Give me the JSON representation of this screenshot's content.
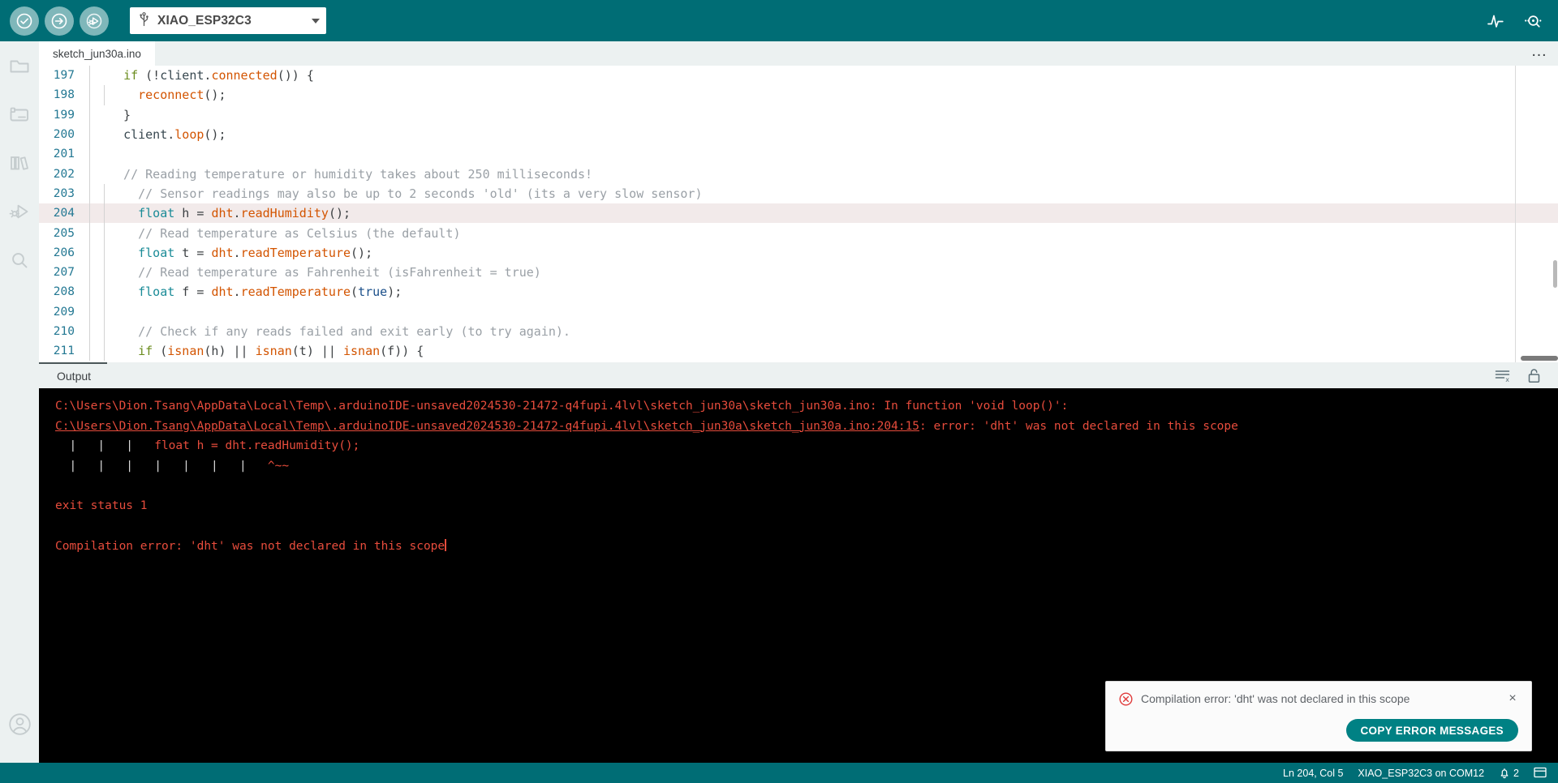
{
  "toolbar": {
    "verify_label": "Verify",
    "upload_label": "Upload",
    "debug_label": "Start Debugging",
    "board_selector": {
      "value": "XIAO_ESP32C3",
      "usb_icon": "usb-icon",
      "caret_icon": "chevron-down-icon"
    },
    "serial_plotter_label": "Serial Plotter",
    "serial_monitor_label": "Serial Monitor"
  },
  "activity_bar": {
    "items": [
      {
        "name": "sketchbook",
        "label": "Sketchbook",
        "icon": "folder-icon"
      },
      {
        "name": "boards-manager",
        "label": "Boards Manager",
        "icon": "boards-manager-icon"
      },
      {
        "name": "library-manager",
        "label": "Library Manager",
        "icon": "books-icon"
      },
      {
        "name": "debug",
        "label": "Debug",
        "icon": "debug-icon"
      },
      {
        "name": "search",
        "label": "Search",
        "icon": "magnifier-icon"
      }
    ],
    "account": {
      "label": "Account",
      "icon": "account-circle-icon"
    }
  },
  "tabs": {
    "items": [
      {
        "label": "sketch_jun30a.ino",
        "active": true
      }
    ],
    "more_label": "…"
  },
  "editor": {
    "lines": [
      {
        "num": "197",
        "indent": 1,
        "tokens": [
          {
            "t": "  ",
            "c": "t-punct"
          },
          {
            "t": "if",
            "c": "t-key"
          },
          {
            "t": " (!",
            "c": "t-punct"
          },
          {
            "t": "client",
            "c": "t-var"
          },
          {
            "t": ".",
            "c": "t-punct"
          },
          {
            "t": "connected",
            "c": "t-fn"
          },
          {
            "t": "()) {",
            "c": "t-punct"
          }
        ]
      },
      {
        "num": "198",
        "indent": 2,
        "tokens": [
          {
            "t": "    ",
            "c": "t-punct"
          },
          {
            "t": "reconnect",
            "c": "t-fn"
          },
          {
            "t": "();",
            "c": "t-punct"
          }
        ]
      },
      {
        "num": "199",
        "indent": 1,
        "tokens": [
          {
            "t": "  }",
            "c": "t-punct"
          }
        ]
      },
      {
        "num": "200",
        "indent": 1,
        "tokens": [
          {
            "t": "  ",
            "c": "t-punct"
          },
          {
            "t": "client",
            "c": "t-var"
          },
          {
            "t": ".",
            "c": "t-punct"
          },
          {
            "t": "loop",
            "c": "t-fn"
          },
          {
            "t": "();",
            "c": "t-punct"
          }
        ]
      },
      {
        "num": "201",
        "indent": 1,
        "tokens": [
          {
            "t": "",
            "c": "t-punct"
          }
        ]
      },
      {
        "num": "202",
        "indent": 1,
        "tokens": [
          {
            "t": "  // Reading temperature or humidity takes about 250 milliseconds!",
            "c": "t-cmt"
          }
        ]
      },
      {
        "num": "203",
        "indent": 2,
        "tokens": [
          {
            "t": "    // Sensor readings may also be up to 2 seconds 'old' (its a very slow sensor)",
            "c": "t-cmt"
          }
        ]
      },
      {
        "num": "204",
        "indent": 2,
        "highlight": true,
        "tokens": [
          {
            "t": "    ",
            "c": "t-punct"
          },
          {
            "t": "float",
            "c": "t-type"
          },
          {
            "t": " h = ",
            "c": "t-punct"
          },
          {
            "t": "dht",
            "c": "t-fn"
          },
          {
            "t": ".",
            "c": "t-punct"
          },
          {
            "t": "readHumidity",
            "c": "t-fn"
          },
          {
            "t": "();",
            "c": "t-punct"
          }
        ]
      },
      {
        "num": "205",
        "indent": 2,
        "tokens": [
          {
            "t": "    // Read temperature as Celsius (the default)",
            "c": "t-cmt"
          }
        ]
      },
      {
        "num": "206",
        "indent": 2,
        "tokens": [
          {
            "t": "    ",
            "c": "t-punct"
          },
          {
            "t": "float",
            "c": "t-type"
          },
          {
            "t": " t = ",
            "c": "t-punct"
          },
          {
            "t": "dht",
            "c": "t-fn"
          },
          {
            "t": ".",
            "c": "t-punct"
          },
          {
            "t": "readTemperature",
            "c": "t-fn"
          },
          {
            "t": "();",
            "c": "t-punct"
          }
        ]
      },
      {
        "num": "207",
        "indent": 2,
        "tokens": [
          {
            "t": "    // Read temperature as Fahrenheit (isFahrenheit = true)",
            "c": "t-cmt"
          }
        ]
      },
      {
        "num": "208",
        "indent": 2,
        "tokens": [
          {
            "t": "    ",
            "c": "t-punct"
          },
          {
            "t": "float",
            "c": "t-type"
          },
          {
            "t": " f = ",
            "c": "t-punct"
          },
          {
            "t": "dht",
            "c": "t-fn"
          },
          {
            "t": ".",
            "c": "t-punct"
          },
          {
            "t": "readTemperature",
            "c": "t-fn"
          },
          {
            "t": "(",
            "c": "t-punct"
          },
          {
            "t": "true",
            "c": "t-const"
          },
          {
            "t": ");",
            "c": "t-punct"
          }
        ]
      },
      {
        "num": "209",
        "indent": 2,
        "tokens": [
          {
            "t": "",
            "c": "t-punct"
          }
        ]
      },
      {
        "num": "210",
        "indent": 2,
        "tokens": [
          {
            "t": "    // Check if any reads failed and exit early (to try again).",
            "c": "t-cmt"
          }
        ]
      },
      {
        "num": "211",
        "indent": 2,
        "tokens": [
          {
            "t": "    ",
            "c": "t-punct"
          },
          {
            "t": "if",
            "c": "t-key"
          },
          {
            "t": " (",
            "c": "t-punct"
          },
          {
            "t": "isnan",
            "c": "t-fn"
          },
          {
            "t": "(h) || ",
            "c": "t-punct"
          },
          {
            "t": "isnan",
            "c": "t-fn"
          },
          {
            "t": "(t) || ",
            "c": "t-punct"
          },
          {
            "t": "isnan",
            "c": "t-fn"
          },
          {
            "t": "(f)) {",
            "c": "t-punct"
          }
        ]
      }
    ]
  },
  "output_panel": {
    "tab_label": "Output",
    "clear_label": "Clear Output",
    "lock_label": "Toggle Auto Scrolling",
    "console_lines": [
      {
        "type": "plain",
        "text": "C:\\Users\\Dion.Tsang\\AppData\\Local\\Temp\\.arduinoIDE-unsaved2024530-21472-q4fupi.4lvl\\sketch_jun30a\\sketch_jun30a.ino: In function 'void loop()':"
      },
      {
        "type": "link",
        "text": "C:\\Users\\Dion.Tsang\\AppData\\Local\\Temp\\.arduinoIDE-unsaved2024530-21472-q4fupi.4lvl\\sketch_jun30a\\sketch_jun30a.ino:204:15",
        "suffix": ": error: 'dht' was not declared in this scope"
      },
      {
        "type": "bars",
        "bars": "  |   |   |   ",
        "text": "float h = dht.readHumidity();"
      },
      {
        "type": "bars",
        "bars": "  |   |   |   |   |   |   |   ",
        "text": "^~~"
      },
      {
        "type": "plain",
        "text": ""
      },
      {
        "type": "plain",
        "text": "exit status 1"
      },
      {
        "type": "plain",
        "text": ""
      },
      {
        "type": "cursor",
        "text": "Compilation error: 'dht' was not declared in this scope"
      }
    ]
  },
  "toast": {
    "icon": "error-circle-icon",
    "message": "Compilation error: 'dht' was not declared in this scope",
    "close_label": "×",
    "button_label": "COPY ERROR MESSAGES"
  },
  "status_bar": {
    "cursor_position": "Ln 204, Col 5",
    "board_port": "XIAO_ESP32C3 on COM12",
    "notification_count": "2",
    "notification_icon": "bell-icon",
    "panel_toggle_icon": "panel-toggle-icon"
  },
  "colors": {
    "brand_teal": "#006d75",
    "accent_teal": "#008184",
    "error_red": "#e74c3c",
    "console_bg": "#000000",
    "chrome_bg": "#ecf1f1"
  }
}
